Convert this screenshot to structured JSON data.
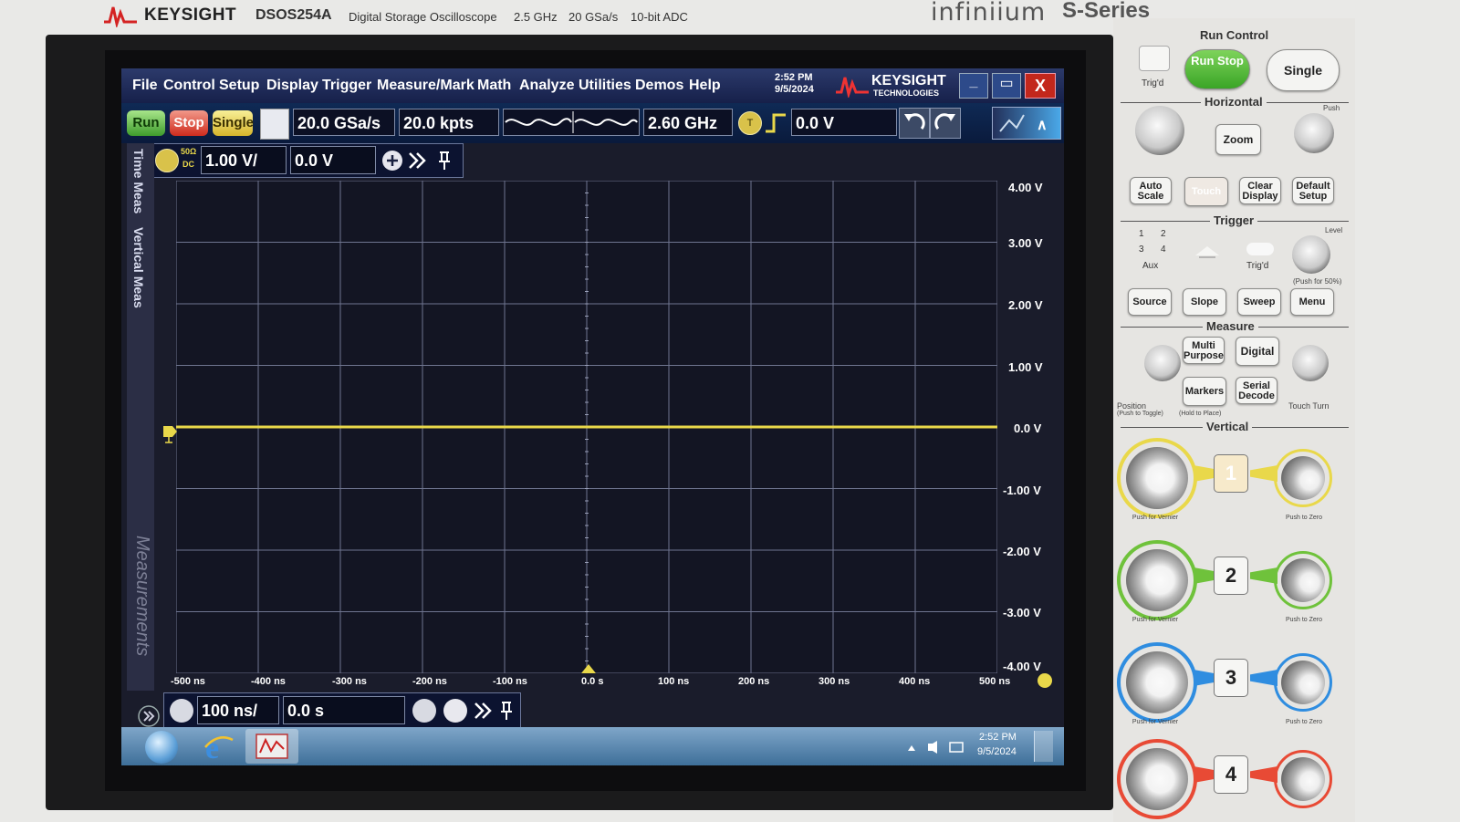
{
  "header": {
    "brand": "KEYSIGHT",
    "model": "DSOS254A",
    "description": "Digital Storage Oscilloscope",
    "bandwidth": "2.5 GHz",
    "sample_rate": "20 GSa/s",
    "adc": "10-bit ADC",
    "product_family": "infiniium",
    "series": "S-Series"
  },
  "menu": [
    "File",
    "Control",
    "Setup",
    "Display",
    "Trigger",
    "Measure/Mark",
    "Math",
    "Analyze",
    "Utilities",
    "Demos",
    "Help"
  ],
  "clock": {
    "time": "2:52 PM",
    "date": "9/5/2024"
  },
  "logo": {
    "brand": "KEYSIGHT",
    "sub": "TECHNOLOGIES"
  },
  "window_controls": {
    "minimize": "_",
    "restore": "▭",
    "close": "X"
  },
  "control_bar": {
    "run": "Run",
    "stop": "Stop",
    "single": "Single",
    "sample_rate": "20.0 GSa/s",
    "memory_depth": "20.0 kpts",
    "bandwidth": "2.60 GHz",
    "trigger_source": "T",
    "trigger_level": "0.0 V"
  },
  "channel_bar": {
    "impedance": "50Ω",
    "coupling": "DC",
    "scale": "1.00 V/",
    "offset": "0.0 V"
  },
  "side_tabs": [
    "Time Meas",
    "Vertical Meas",
    "Measurements"
  ],
  "grid": {
    "cols": 10,
    "rows": 8
  },
  "y_ticks": [
    "4.00 V",
    "3.00 V",
    "2.00 V",
    "1.00 V",
    "0.0 V",
    "-1.00 V",
    "-2.00 V",
    "-3.00 V",
    "-4.00 V"
  ],
  "x_ticks": [
    "-500 ns",
    "-400 ns",
    "-300 ns",
    "-200 ns",
    "-100 ns",
    "0.0 s",
    "100 ns",
    "200 ns",
    "300 ns",
    "400 ns",
    "500 ns"
  ],
  "trace": {
    "channel": 1,
    "level_volts": 0.0,
    "color": "#e9d84a"
  },
  "timebase_bar": {
    "scale": "100 ns/",
    "position": "0.0 s"
  },
  "taskbar": {
    "time": "2:52 PM",
    "date": "9/5/2024"
  },
  "panel": {
    "run_control": {
      "title": "Run Control",
      "trigd": "Trig'd",
      "run_stop": "Run Stop",
      "single": "Single"
    },
    "horizontal": {
      "title": "Horizontal",
      "zoom": "Zoom",
      "auto_scale": "Auto Scale",
      "touch": "Touch",
      "clear_display": "Clear Display",
      "default_setup": "Default Setup",
      "push": "Push"
    },
    "trigger": {
      "title": "Trigger",
      "level": "Level",
      "ch_labels": [
        "1",
        "2",
        "3",
        "4"
      ],
      "aux": "Aux",
      "trigd": "Trig'd",
      "push50": "(Push for 50%)",
      "source": "Source",
      "slope": "Slope",
      "sweep": "Sweep",
      "menu": "Menu"
    },
    "measure": {
      "title": "Measure",
      "multi_purpose": "Multi Purpose",
      "digital": "Digital",
      "markers": "Markers",
      "serial_decode": "Serial Decode",
      "position": "Position",
      "push_toggle": "(Push to Toggle)",
      "hold_place": "(Hold to Place)",
      "touch_turn": "Touch Turn"
    },
    "vertical": {
      "title": "Vertical",
      "channels": [
        "1",
        "2",
        "3",
        "4"
      ],
      "push_vernier": "Push for Vernier",
      "push_zero": "Push to Zero"
    }
  },
  "colors": {
    "ch1": "#e9d84a",
    "ch2": "#6fc23b",
    "ch3": "#2f8de0",
    "ch4": "#e84a35"
  }
}
